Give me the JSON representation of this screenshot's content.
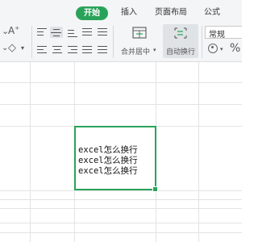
{
  "ribbon": {
    "tabs": [
      {
        "label": "开始",
        "active": true
      },
      {
        "label": "插入",
        "active": false
      },
      {
        "label": "页面布局",
        "active": false
      },
      {
        "label": "公式",
        "active": false
      }
    ]
  },
  "toolbar": {
    "merge_center_label": "合并居中",
    "wrap_text_label": "自动换行",
    "number_format_value": "常规",
    "percent_symbol": "%"
  },
  "sheet": {
    "active_cell_lines": [
      "excel怎么换行",
      "excel怎么换行",
      "excel怎么换行"
    ]
  },
  "colors": {
    "accent": "#2aa35a",
    "ribbon_bg": "#f4f5f6",
    "grid": "#e3e3e3"
  }
}
